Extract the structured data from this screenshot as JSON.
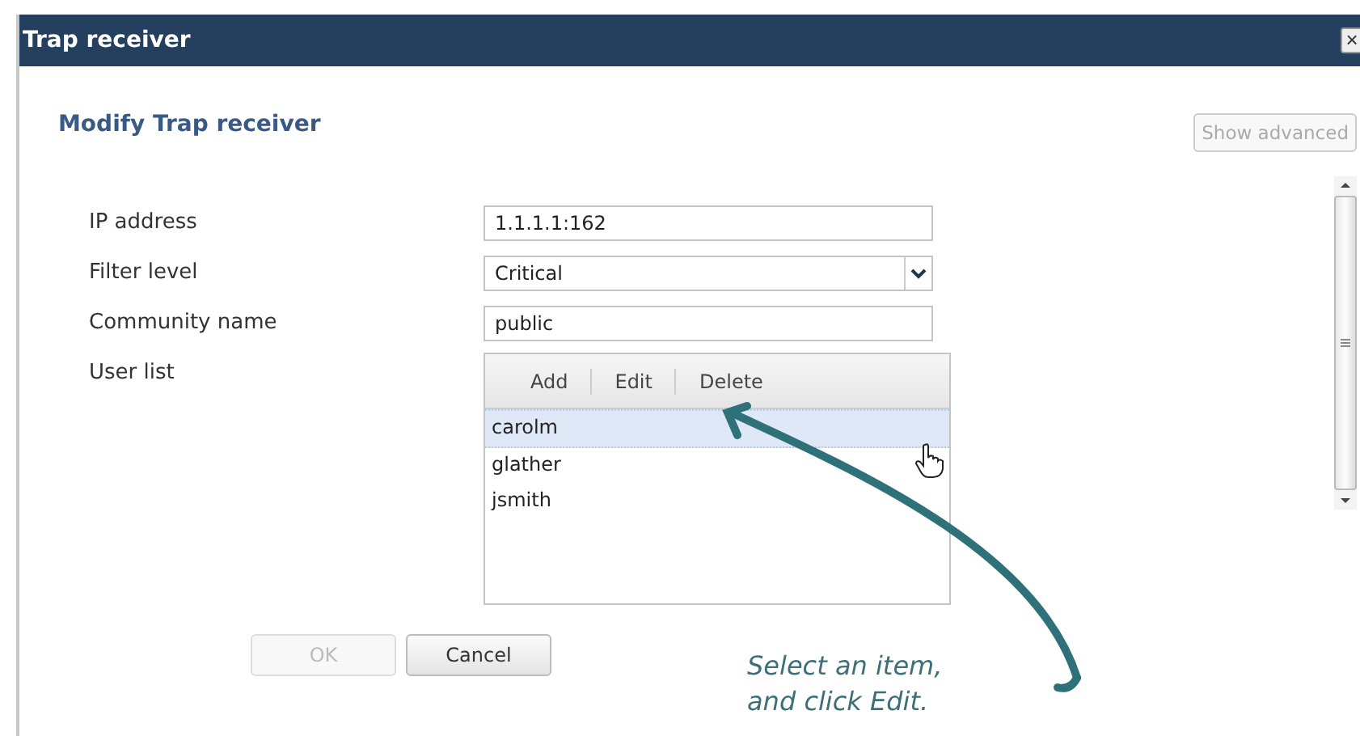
{
  "window": {
    "title": "Trap receiver",
    "close": "×"
  },
  "heading": "Modify Trap receiver",
  "show_advanced": {
    "label": "Show advanced",
    "disabled": true
  },
  "fields": [
    {
      "kind": "text",
      "label": "IP address",
      "value": "1.1.1.1:162"
    },
    {
      "kind": "select",
      "label": "Filter level",
      "value": "Critical"
    },
    {
      "kind": "text",
      "label": "Community name",
      "value": "public"
    },
    {
      "kind": "list",
      "label": "User list",
      "actions": [
        "Add",
        "Edit",
        "Delete"
      ],
      "items": [
        {
          "text": "carolm",
          "selected": true
        },
        {
          "text": "glather",
          "selected": false
        },
        {
          "text": "jsmith",
          "selected": false
        }
      ]
    }
  ],
  "buttons": [
    {
      "label": "OK",
      "disabled": true
    },
    {
      "label": "Cancel",
      "disabled": false
    }
  ],
  "callout": {
    "lines": [
      "Select an item,",
      "and click Edit."
    ]
  }
}
